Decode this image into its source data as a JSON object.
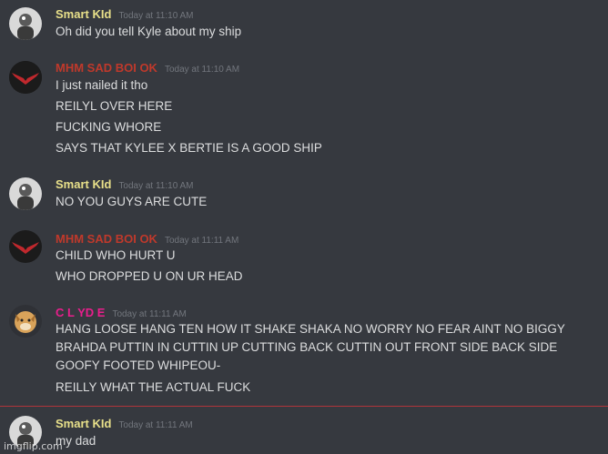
{
  "users": {
    "smart": {
      "name": "Smart KId",
      "color": "#e8e08a"
    },
    "mhm": {
      "name": "MHM SAD BOI OK",
      "color": "#c0392b"
    },
    "clyde": {
      "name": "C L YD E",
      "color": "#e91e8c"
    }
  },
  "messages": [
    {
      "user": "smart",
      "time": "Today at 11:10 AM",
      "lines": [
        "Oh did you tell Kyle about my ship"
      ]
    },
    {
      "user": "mhm",
      "time": "Today at 11:10 AM",
      "lines": [
        "I just nailed it tho",
        "REILYL OVER HERE",
        "FUCKING WHORE",
        "SAYS THAT KYLEE X BERTIE IS A GOOD SHIP"
      ]
    },
    {
      "user": "smart",
      "time": "Today at 11:10 AM",
      "lines": [
        "NO YOU GUYS ARE CUTE"
      ]
    },
    {
      "user": "mhm",
      "time": "Today at 11:11 AM",
      "lines": [
        "CHILD WHO HURT U",
        "WHO DROPPED U ON UR HEAD"
      ]
    },
    {
      "user": "clyde",
      "time": "Today at 11:11 AM",
      "lines": [
        "HANG LOOSE HANG TEN HOW IT SHAKE SHAKA NO WORRY NO FEAR AINT NO BIGGY BRAHDA PUTTIN IN CUTTIN UP CUTTING BACK CUTTIN OUT FRONT SIDE BACK SIDE GOOFY FOOTED WHIPEOU-",
        "REILLY WHAT THE ACTUAL FUCK"
      ]
    },
    {
      "user": "smart",
      "time": "Today at 11:11 AM",
      "lines": [
        "my dad"
      ]
    }
  ],
  "watermark": "imgflip.com"
}
